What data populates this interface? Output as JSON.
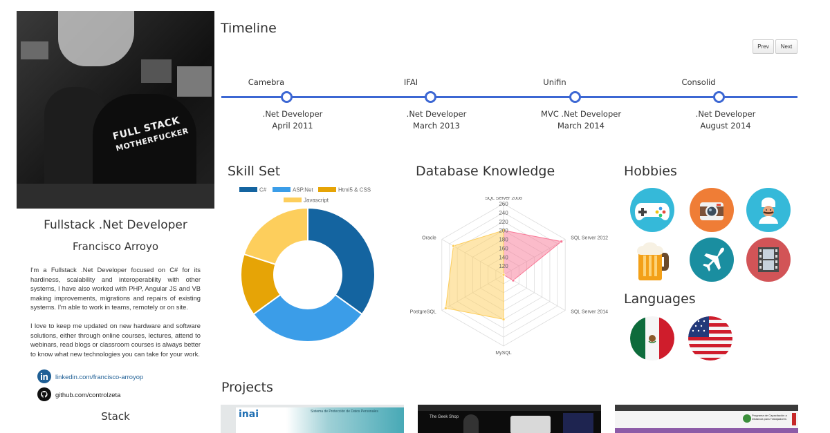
{
  "sidebar": {
    "role_title": "Fullstack .Net Developer",
    "name": "Francisco Arroyo",
    "photo_shirt_text": [
      "FULL STACK",
      "MOTHERFUCKER"
    ],
    "bio": [
      "I'm a Fullstack .Net Developer focused on C# for its hardiness, scalability and interoperability with other systems, I have also worked with PHP, Angular JS and VB making improvements, migrations and repairs of existing systems. I'm able to work in teams, remotely or on site.",
      "I love to keep me updated on new hardware and software solutions, either through online courses, lectures, attend to webinars, read blogs or classroom courses is always better to know what new technologies you can take for your work."
    ],
    "links": {
      "linkedin": "linkedin.com/francisco-arroyop",
      "github": "github.com/controlzeta"
    },
    "stack_heading": "Stack"
  },
  "timeline": {
    "heading": "Timeline",
    "prev_label": "Prev",
    "next_label": "Next",
    "accent_color": "#3c67d3",
    "items": [
      {
        "company": "Camebra",
        "role": ".Net Developer",
        "date": "April 2011"
      },
      {
        "company": "IFAI",
        "role": ".Net Developer",
        "date": "March 2013"
      },
      {
        "company": "Unifin",
        "role": "MVC .Net Developer",
        "date": "March 2014"
      },
      {
        "company": "Consolid",
        "role": ".Net Developer",
        "date": "August 2014"
      }
    ]
  },
  "skills": {
    "heading": "Skill Set",
    "chart_data": {
      "type": "pie",
      "donut": true,
      "legend_position": "top",
      "categories": [
        "C#",
        "ASP.Net",
        "Html5 & CSS",
        "Javascript"
      ],
      "values": [
        35,
        30,
        15,
        20
      ],
      "colors": [
        "#1464a0",
        "#3b9de8",
        "#e6a406",
        "#fdce5c"
      ]
    }
  },
  "database": {
    "heading": "Database Knowledge",
    "chart_data": {
      "type": "radar",
      "axes": [
        "SQL Server 2008",
        "SQL Server 2012",
        "SQL Server 2014",
        "MySQL",
        "PostgreSQL",
        "Oracle"
      ],
      "scale_ticks": [
        120,
        140,
        160,
        180,
        200,
        220,
        240,
        260
      ],
      "range": [
        100,
        260
      ],
      "series": [
        {
          "values": [
            200,
            250,
            125,
            100,
            100,
            100
          ],
          "color": "#f87896"
        },
        {
          "values": [
            200,
            100,
            100,
            200,
            250,
            230
          ],
          "color": "#fdce5c"
        }
      ]
    }
  },
  "hobbies": {
    "heading": "Hobbies",
    "items": [
      {
        "icon": "gamepad-icon",
        "color": "#35b9d9"
      },
      {
        "icon": "camera-icon",
        "color": "#ef7d36"
      },
      {
        "icon": "chef-icon",
        "color": "#35b9d9"
      },
      {
        "icon": "beer-icon",
        "color": "#f3a018"
      },
      {
        "icon": "airplane-icon",
        "color": "#1a8ea0"
      },
      {
        "icon": "film-icon",
        "color": "#d25457"
      }
    ]
  },
  "languages": {
    "heading": "Languages",
    "items": [
      {
        "icon": "mexico-flag-icon"
      },
      {
        "icon": "usa-flag-icon"
      }
    ]
  },
  "projects": {
    "heading": "Projects",
    "items": [
      {
        "logo_text": "inai",
        "banner_text": "Sistema de Protección de Datos Personales"
      },
      {
        "logo_text": "The Geek Shop"
      },
      {
        "logo_text": "Programa de Capacitación a Distancia para Trabajadores"
      }
    ]
  }
}
